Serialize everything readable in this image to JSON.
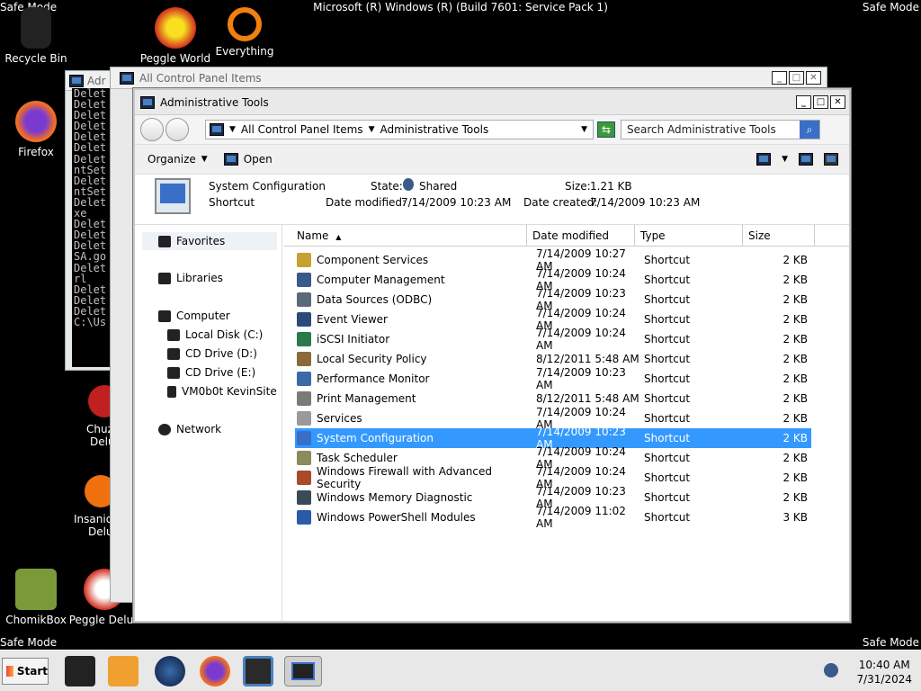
{
  "desktop": {
    "safe_mode": "Safe Mode",
    "os_title": "Microsoft (R) Windows (R) (Build 7601: Service Pack 1)",
    "icons": [
      {
        "label": "Recycle Bin",
        "icon": "recycle-bin-icon"
      },
      {
        "label": "Peggle World",
        "icon": "peggle-icon"
      },
      {
        "label": "Everything",
        "icon": "search-magnifier-icon"
      },
      {
        "label": "Firefox",
        "icon": "firefox-icon"
      },
      {
        "label": "Chuz",
        "icon": "chuzzle-icon"
      },
      {
        "label": "Delu",
        "icon": ""
      },
      {
        "label": "Insaniq",
        "icon": "insaniquarium-icon"
      },
      {
        "label": "Delu",
        "icon": ""
      },
      {
        "label": "ChomikBox",
        "icon": "chomikbox-icon"
      },
      {
        "label": "Peggle Delux",
        "icon": "peggle-deluxe-icon"
      }
    ]
  },
  "bg_windows": {
    "console_title": "Adr",
    "console_lines": [
      "Delet",
      "Delet",
      "Delet",
      "Delet",
      "Delet",
      "Delet",
      "Delet",
      "ntSet",
      "Delet",
      "ntSet",
      "Delet",
      "xe",
      "Delet",
      "Delet",
      "Delet",
      "SA.go",
      "Delet",
      "rl",
      "Delet",
      "Delet",
      "Delet",
      "",
      "C:\\Us"
    ],
    "cp_title": "All Control Panel Items"
  },
  "window": {
    "title": "Administrative Tools",
    "address": [
      "All Control Panel Items",
      "Administrative Tools"
    ],
    "search_placeholder": "Search Administrative Tools",
    "toolbar": {
      "organize": "Organize",
      "open": "Open"
    },
    "details": {
      "name": "System Configuration",
      "type": "Shortcut",
      "state_label": "State:",
      "state_value": "Shared",
      "size_label": "Size:",
      "size_value": "1.21 KB",
      "modified_label": "Date modified:",
      "modified_value": "7/14/2009 10:23 AM",
      "created_label": "Date created:",
      "created_value": "7/14/2009 10:23 AM"
    },
    "sidebar": {
      "favorites": "Favorites",
      "libraries": "Libraries",
      "computer": "Computer",
      "drives": [
        "Local Disk (C:)",
        "CD Drive (D:)",
        "CD Drive (E:)",
        "VM0b0t KevinSite"
      ],
      "network": "Network"
    },
    "columns": {
      "name": "Name",
      "date": "Date modified",
      "type": "Type",
      "size": "Size"
    },
    "files": [
      {
        "name": "Component Services",
        "date": "7/14/2009 10:27 AM",
        "type": "Shortcut",
        "size": "2 KB",
        "color": "#c8a030"
      },
      {
        "name": "Computer Management",
        "date": "7/14/2009 10:24 AM",
        "type": "Shortcut",
        "size": "2 KB",
        "color": "#3a5a8a"
      },
      {
        "name": "Data Sources (ODBC)",
        "date": "7/14/2009 10:23 AM",
        "type": "Shortcut",
        "size": "2 KB",
        "color": "#5a6a7a"
      },
      {
        "name": "Event Viewer",
        "date": "7/14/2009 10:24 AM",
        "type": "Shortcut",
        "size": "2 KB",
        "color": "#2a4a7a"
      },
      {
        "name": "iSCSI Initiator",
        "date": "7/14/2009 10:24 AM",
        "type": "Shortcut",
        "size": "2 KB",
        "color": "#2a7a4a"
      },
      {
        "name": "Local Security Policy",
        "date": "8/12/2011 5:48 AM",
        "type": "Shortcut",
        "size": "2 KB",
        "color": "#8a6a3a"
      },
      {
        "name": "Performance Monitor",
        "date": "7/14/2009 10:23 AM",
        "type": "Shortcut",
        "size": "2 KB",
        "color": "#3a6aaa"
      },
      {
        "name": "Print Management",
        "date": "8/12/2011 5:48 AM",
        "type": "Shortcut",
        "size": "2 KB",
        "color": "#7a7a7a"
      },
      {
        "name": "Services",
        "date": "7/14/2009 10:24 AM",
        "type": "Shortcut",
        "size": "2 KB",
        "color": "#9a9a9a"
      },
      {
        "name": "System Configuration",
        "date": "7/14/2009 10:23 AM",
        "type": "Shortcut",
        "size": "2 KB",
        "color": "#3a6fc8",
        "selected": true
      },
      {
        "name": "Task Scheduler",
        "date": "7/14/2009 10:24 AM",
        "type": "Shortcut",
        "size": "2 KB",
        "color": "#8a8a5a"
      },
      {
        "name": "Windows Firewall with Advanced Security",
        "date": "7/14/2009 10:24 AM",
        "type": "Shortcut",
        "size": "2 KB",
        "color": "#aa4a2a"
      },
      {
        "name": "Windows Memory Diagnostic",
        "date": "7/14/2009 10:23 AM",
        "type": "Shortcut",
        "size": "2 KB",
        "color": "#3a4a5a"
      },
      {
        "name": "Windows PowerShell Modules",
        "date": "7/14/2009 11:02 AM",
        "type": "Shortcut",
        "size": "3 KB",
        "color": "#2a5aaa"
      }
    ]
  },
  "taskbar": {
    "start": "Start",
    "time": "10:40 AM",
    "date": "7/31/2024"
  }
}
